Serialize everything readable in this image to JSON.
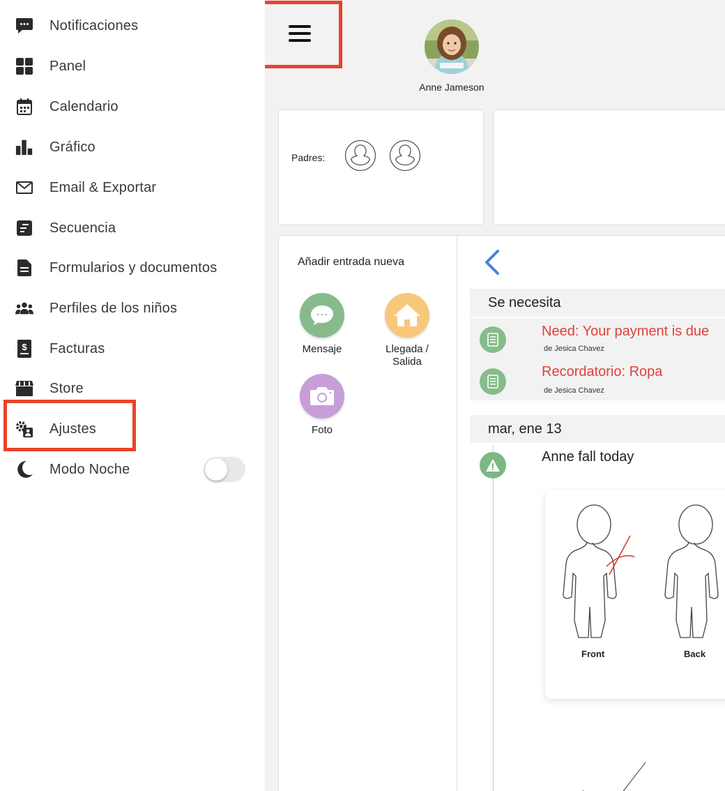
{
  "sidebar": {
    "items": [
      {
        "label": "Notificaciones",
        "icon": "chat-bubble-icon"
      },
      {
        "label": "Panel",
        "icon": "grid-icon"
      },
      {
        "label": "Calendario",
        "icon": "calendar-icon"
      },
      {
        "label": "Gráfico",
        "icon": "bar-chart-icon"
      },
      {
        "label": "Email & Exportar",
        "icon": "envelope-icon"
      },
      {
        "label": "Secuencia",
        "icon": "sequence-icon"
      },
      {
        "label": "Formularios y documentos",
        "icon": "document-icon"
      },
      {
        "label": "Perfiles de los niños",
        "icon": "group-icon"
      },
      {
        "label": "Facturas",
        "icon": "invoice-icon"
      },
      {
        "label": "Store",
        "icon": "store-icon"
      },
      {
        "label": "Ajustes",
        "icon": "settings-icon"
      },
      {
        "label": "Modo Noche",
        "icon": "moon-icon"
      }
    ],
    "night_mode_on": false
  },
  "header": {
    "child_name": "Anne Jameson"
  },
  "parents": {
    "label": "Padres:"
  },
  "add_entry": {
    "title": "Añadir entrada nueva",
    "actions": [
      {
        "label": "Mensaje",
        "color": "#88bb8c"
      },
      {
        "label": "Llegada /",
        "label2": "Salida",
        "color": "#f8c87a"
      },
      {
        "label": "Foto",
        "color": "#c79ed8"
      }
    ]
  },
  "feed": {
    "needs_header": "Se necesita",
    "needs": [
      {
        "title": "Need: Your payment is due",
        "by": "de Jesica Chavez"
      },
      {
        "title": "Recordatorio: Ropa",
        "by": "de Jesica Chavez"
      }
    ],
    "date_header": "mar, ene 13",
    "entry_title": "Anne fall today",
    "body_front": "Front",
    "body_back": "Back"
  },
  "colors": {
    "highlight": "#e8432b",
    "need_red": "#e04139",
    "accent_blue": "#4a7fe0"
  }
}
